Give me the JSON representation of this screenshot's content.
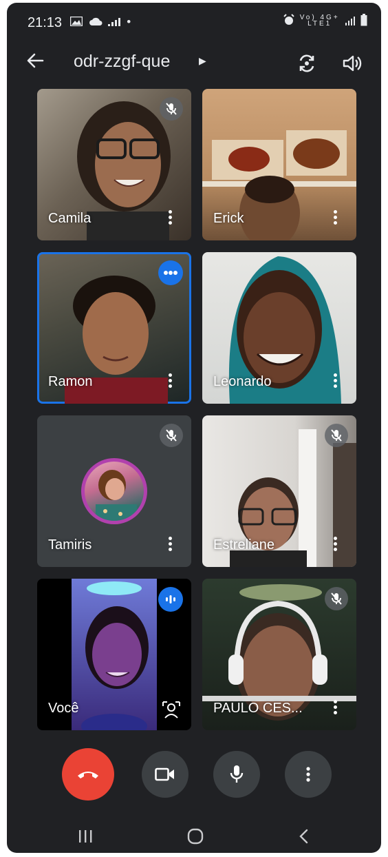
{
  "status_bar": {
    "time": "21:13",
    "left_icons": [
      "image-icon",
      "cloud-icon",
      "signal-bars-icon",
      "dot-icon"
    ],
    "right_text": "Vo) 4G+",
    "right_sub": "LTE1"
  },
  "header": {
    "meeting_code": "odr-zzgf-que"
  },
  "participants": [
    {
      "name": "Camila",
      "muted": true,
      "speaking": false
    },
    {
      "name": "Erick",
      "muted": false,
      "speaking": false
    },
    {
      "name": "Ramon",
      "muted": false,
      "speaking": true
    },
    {
      "name": "Leonardo",
      "muted": false,
      "speaking": false
    },
    {
      "name": "Tamiris",
      "muted": true,
      "speaking": false,
      "camera_off": true
    },
    {
      "name": "Estreliane",
      "muted": true,
      "speaking": false
    },
    {
      "name": "Você",
      "muted": false,
      "speaking": true,
      "self": true
    },
    {
      "name": "PAULO CES...",
      "muted": true,
      "speaking": false
    }
  ],
  "controls": [
    "hang-up",
    "camera",
    "microphone",
    "more-options"
  ],
  "colors": {
    "background": "#202124",
    "tile": "#3c4043",
    "accent_blue": "#1a73e8",
    "hangup_red": "#ea4335"
  }
}
